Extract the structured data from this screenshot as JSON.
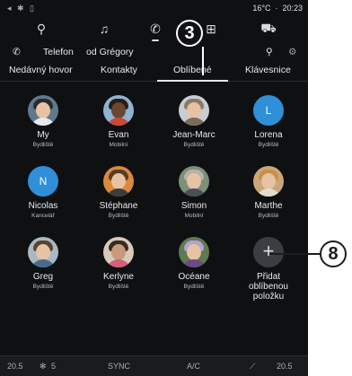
{
  "status": {
    "left_icons": "◂ ✱ ▯",
    "temperature": "16°C",
    "time": "20:23"
  },
  "app_icons": [
    {
      "name": "navigation-icon",
      "glyph": "⚲"
    },
    {
      "name": "music-icon",
      "glyph": "♫"
    },
    {
      "name": "phone-icon",
      "glyph": "✆"
    },
    {
      "name": "apps-icon",
      "glyph": "⊞"
    },
    {
      "name": "car-icon",
      "glyph": "⛟"
    }
  ],
  "toolbar": {
    "phone_icon": "✆",
    "phone_name": "Telefon",
    "owner": "od Grégory",
    "search_icon": "⚲",
    "settings_icon": "⚙"
  },
  "tabs": [
    {
      "label": "Nedávný hovor"
    },
    {
      "label": "Kontakty"
    },
    {
      "label": "Oblíbené",
      "selected": true
    },
    {
      "label": "Klávesnice"
    }
  ],
  "contacts": [
    {
      "name": "My",
      "type": "Bydliště"
    },
    {
      "name": "Evan",
      "type": "Mobilní"
    },
    {
      "name": "Jean-Marc",
      "type": "Bydliště"
    },
    {
      "name": "Lorena",
      "type": "Bydliště",
      "initial": "L"
    },
    {
      "name": "Nicolas",
      "type": "Kancelář",
      "initial": "N"
    },
    {
      "name": "Stéphane",
      "type": "Bydliště"
    },
    {
      "name": "Simon",
      "type": "Mobilní"
    },
    {
      "name": "Marthe",
      "type": "Bydliště"
    },
    {
      "name": "Greg",
      "type": "Bydliště"
    },
    {
      "name": "Kerlyne",
      "type": "Bydliště"
    },
    {
      "name": "Océane",
      "type": "Bydliště"
    }
  ],
  "add_favorite": {
    "glyph": "+",
    "label": "Přidat oblíbenou položku"
  },
  "bottom": {
    "temp_left": "20.5",
    "fan": "5",
    "sync": "SYNC",
    "ac": "A/C",
    "temp_right": "20.5"
  },
  "callouts": {
    "three": "3",
    "eight": "8"
  },
  "colors": {
    "background": "#0f1012",
    "text": "#e8eaed",
    "accent_blue": "#2f8fd8"
  }
}
